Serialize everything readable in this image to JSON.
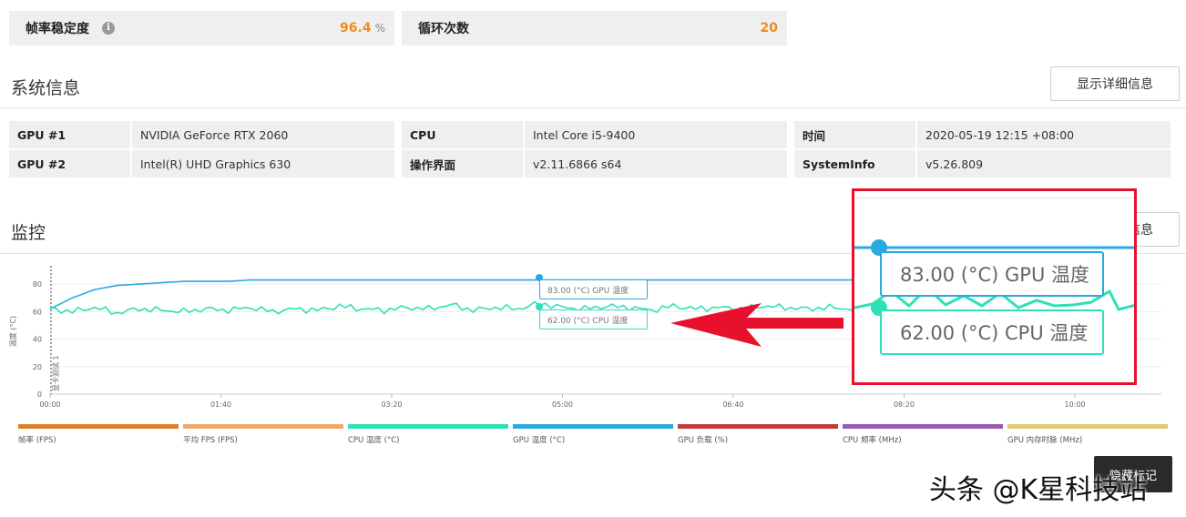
{
  "stats": [
    {
      "label": "帧率稳定度",
      "value": "96.4",
      "unit": "%"
    },
    {
      "label": "循环次数",
      "value": "20",
      "unit": ""
    }
  ],
  "system": {
    "title": "系统信息",
    "detail_button": "显示详细信息",
    "rows": [
      [
        {
          "label": "GPU #1",
          "value": "NVIDIA GeForce RTX 2060"
        },
        {
          "label": "CPU",
          "value": "Intel Core i5-9400"
        },
        {
          "label": "时间",
          "value": "2020-05-19 12:15 +08:00"
        }
      ],
      [
        {
          "label": "GPU #2",
          "value": "Intel(R) UHD Graphics 630"
        },
        {
          "label": "操作界面",
          "value": "v2.11.6866 s64"
        },
        {
          "label": "SystemInfo",
          "value": "v5.26.809"
        }
      ]
    ]
  },
  "monitor": {
    "title": "监控",
    "button_partial": "信息",
    "dark_button": "隐藏标记"
  },
  "chart_data": {
    "type": "line",
    "ylabel": "温度 (°C)",
    "marker_label": "显卡测试 1",
    "ylim": [
      0,
      90
    ],
    "yticks": [
      0,
      20,
      40,
      60,
      80
    ],
    "x_ticks": [
      "00:00",
      "01:40",
      "03:20",
      "05:00",
      "06:40",
      "08:20",
      "10:00"
    ],
    "series": [
      {
        "name": "GPU 温度 (°C)",
        "color": "#29a9e1",
        "values": [
          62,
          70,
          76,
          79,
          80,
          81,
          82,
          82,
          82,
          83,
          83,
          83,
          83,
          83,
          83,
          83,
          83,
          83,
          83,
          83,
          83,
          83,
          83,
          83,
          83,
          83,
          83,
          83,
          83,
          83,
          83,
          83,
          83,
          83,
          83,
          83,
          83
        ]
      },
      {
        "name": "CPU 温度 (°C)",
        "color": "#2ee0b8",
        "values": [
          62,
          60,
          63,
          59,
          62,
          61,
          60,
          62,
          61,
          63,
          60,
          62,
          61,
          64,
          62,
          61,
          63,
          62,
          65,
          61,
          63,
          62,
          66,
          63,
          62,
          64,
          63,
          61,
          64,
          62,
          63,
          62,
          64,
          63,
          62,
          63,
          62
        ]
      }
    ],
    "tooltip": {
      "gpu": "83.00 (°C) GPU 温度",
      "cpu": "62.00 (°C) CPU 温度"
    }
  },
  "legend": [
    {
      "label": "帧率 (FPS)",
      "color": "#e07f2a"
    },
    {
      "label": "平均 FPS (FPS)",
      "color": "#f0a96c"
    },
    {
      "label": "CPU 温度 (°C)",
      "color": "#2ee0b8"
    },
    {
      "label": "GPU 温度 (°C)",
      "color": "#29a9e1"
    },
    {
      "label": "GPU 负载 (%)",
      "color": "#c23b3b"
    },
    {
      "label": "CPU 频率 (MHz)",
      "color": "#9b59b6"
    },
    {
      "label": "GPU 内存时脉 (MHz)",
      "color": "#e0c77a"
    }
  ],
  "watermark": "头条 @K星科技站"
}
